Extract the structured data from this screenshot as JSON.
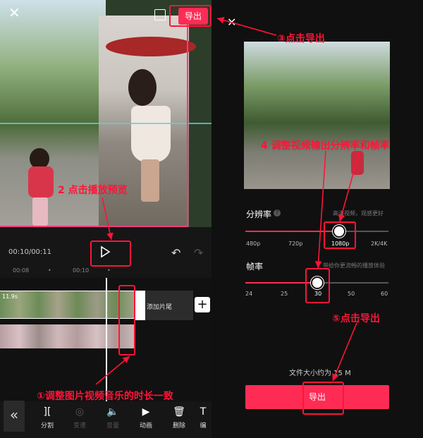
{
  "editor": {
    "export_label": "导出",
    "timecode": "00:10/00:11",
    "ruler_ticks": [
      "00:08",
      "•",
      "00:10",
      "•"
    ],
    "clip_duration": "11.9s",
    "add_tail_label": "添加片尾",
    "add_clip_symbol": "+",
    "collapse_symbol": "«",
    "tools": [
      {
        "icon": "split-icon",
        "glyph": "][",
        "label": "分割",
        "enabled": true
      },
      {
        "icon": "speed-icon",
        "glyph": "◎",
        "label": "变速",
        "enabled": false
      },
      {
        "icon": "volume-icon",
        "glyph": "🔈",
        "label": "音量",
        "enabled": false
      },
      {
        "icon": "animation-icon",
        "glyph": "▶",
        "label": "动画",
        "enabled": true
      },
      {
        "icon": "delete-icon",
        "glyph": "🗑",
        "label": "删除",
        "enabled": true
      },
      {
        "icon": "text-icon",
        "glyph": "T",
        "label": "编",
        "enabled": true
      }
    ]
  },
  "export_panel": {
    "resolution_label": "分辨率",
    "resolution_help": "?",
    "resolution_hint": "高清视频，观感更好",
    "resolution_options": [
      "480p",
      "720p",
      "1080p",
      "2K/4K"
    ],
    "resolution_selected": "1080p",
    "framerate_label": "帧率",
    "framerate_hint": "带给你更流畅的播放体验",
    "framerate_options": [
      "24",
      "25",
      "30",
      "50",
      "60"
    ],
    "framerate_selected": "30",
    "file_size": "文件大小约为 15 M",
    "export_button": "导出"
  },
  "annotations": {
    "step1": "①调整图片视频音乐的时长一致",
    "step2": "2 点击播放预览",
    "step3": "③点击导出",
    "step4": "4 调整视频输出分辨率和帧率",
    "step5": "⑤点击导出"
  },
  "colors": {
    "accent": "#fe2c55",
    "annotation": "#ff1438",
    "background": "#111111"
  }
}
